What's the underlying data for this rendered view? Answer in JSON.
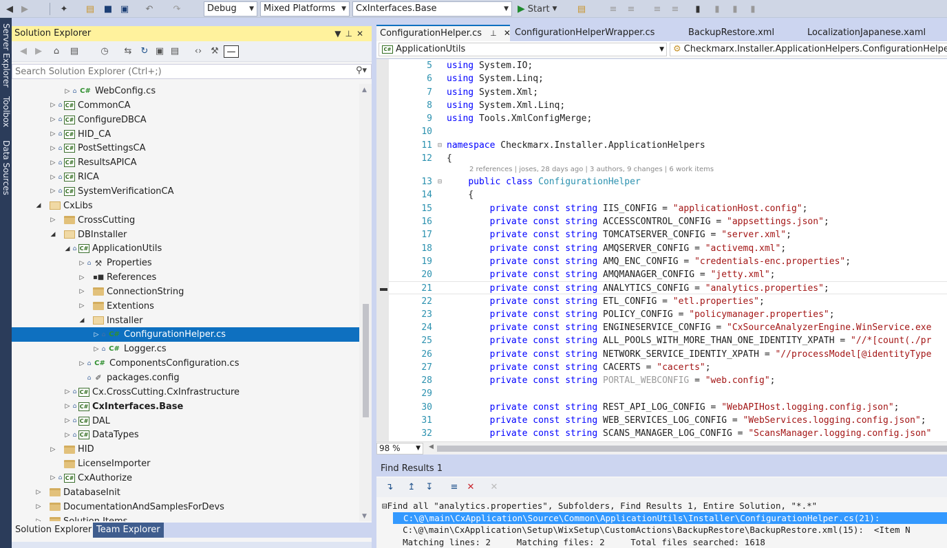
{
  "toolbar": {
    "config": "Debug",
    "platform": "Mixed Platforms",
    "startup_project": "CxInterfaces.Base",
    "start_label": "Start"
  },
  "left_strip": {
    "tabs": [
      "Server Explorer",
      "Toolbox",
      "Data Sources"
    ]
  },
  "solution_explorer": {
    "title": "Solution Explorer",
    "search_placeholder": "Search Solution Explorer (Ctrl+;)",
    "tree": [
      {
        "label": "WebConfig.cs",
        "indent": 3,
        "expander": "collapsed",
        "lock": true,
        "icon": "cs"
      },
      {
        "label": "CommonCA",
        "indent": 2,
        "expander": "collapsed",
        "lock": true,
        "icon": "proj"
      },
      {
        "label": "ConfigureDBCA",
        "indent": 2,
        "expander": "collapsed",
        "lock": true,
        "icon": "proj"
      },
      {
        "label": "HID_CA",
        "indent": 2,
        "expander": "collapsed",
        "lock": true,
        "icon": "proj"
      },
      {
        "label": "PostSettingsCA",
        "indent": 2,
        "expander": "collapsed",
        "lock": true,
        "icon": "proj"
      },
      {
        "label": "ResultsAPICA",
        "indent": 2,
        "expander": "collapsed",
        "lock": true,
        "icon": "proj"
      },
      {
        "label": "RICA",
        "indent": 2,
        "expander": "collapsed",
        "lock": true,
        "icon": "proj"
      },
      {
        "label": "SystemVerificationCA",
        "indent": 2,
        "expander": "collapsed",
        "lock": true,
        "icon": "proj"
      },
      {
        "label": "CxLibs",
        "indent": 1,
        "expander": "expanded",
        "lock": false,
        "icon": "open"
      },
      {
        "label": "CrossCutting",
        "indent": 2,
        "expander": "collapsed",
        "lock": false,
        "icon": "folder"
      },
      {
        "label": "DBInstaller",
        "indent": 2,
        "expander": "expanded",
        "lock": false,
        "icon": "open"
      },
      {
        "label": "ApplicationUtils",
        "indent": 3,
        "expander": "expanded",
        "lock": true,
        "icon": "proj"
      },
      {
        "label": "Properties",
        "indent": 4,
        "expander": "collapsed",
        "lock": true,
        "icon": "wrench"
      },
      {
        "label": "References",
        "indent": 4,
        "expander": "collapsed",
        "lock": false,
        "icon": "refs"
      },
      {
        "label": "ConnectionString",
        "indent": 4,
        "expander": "collapsed",
        "lock": false,
        "icon": "folder"
      },
      {
        "label": "Extentions",
        "indent": 4,
        "expander": "collapsed",
        "lock": false,
        "icon": "folder"
      },
      {
        "label": "Installer",
        "indent": 4,
        "expander": "expanded",
        "lock": false,
        "icon": "open"
      },
      {
        "label": "ConfigurationHelper.cs",
        "indent": 5,
        "expander": "collapsed",
        "lock": true,
        "icon": "cs",
        "selected": true
      },
      {
        "label": "Logger.cs",
        "indent": 5,
        "expander": "collapsed",
        "lock": true,
        "icon": "cs"
      },
      {
        "label": "ComponentsConfiguration.cs",
        "indent": 4,
        "expander": "collapsed",
        "lock": true,
        "icon": "cs"
      },
      {
        "label": "packages.config",
        "indent": 4,
        "expander": "none",
        "lock": true,
        "icon": "pkg"
      },
      {
        "label": "Cx.CrossCutting.CxInfrastructure",
        "indent": 3,
        "expander": "collapsed",
        "lock": true,
        "icon": "proj"
      },
      {
        "label": "CxInterfaces.Base",
        "indent": 3,
        "expander": "collapsed",
        "lock": true,
        "icon": "proj",
        "bold": true
      },
      {
        "label": "DAL",
        "indent": 3,
        "expander": "collapsed",
        "lock": true,
        "icon": "proj"
      },
      {
        "label": "DataTypes",
        "indent": 3,
        "expander": "collapsed",
        "lock": true,
        "icon": "proj"
      },
      {
        "label": "HID",
        "indent": 2,
        "expander": "collapsed",
        "lock": false,
        "icon": "folder"
      },
      {
        "label": "LicenseImporter",
        "indent": 2,
        "expander": "none",
        "lock": false,
        "icon": "folder"
      },
      {
        "label": "CxAuthorize",
        "indent": 2,
        "expander": "collapsed",
        "lock": true,
        "icon": "proj"
      },
      {
        "label": "DatabaseInit",
        "indent": 1,
        "expander": "collapsed",
        "lock": false,
        "icon": "folder"
      },
      {
        "label": "DocumentationAndSamplesForDevs",
        "indent": 1,
        "expander": "collapsed",
        "lock": false,
        "icon": "folder"
      },
      {
        "label": "Solution Items",
        "indent": 1,
        "expander": "collapsed",
        "lock": false,
        "icon": "folder"
      }
    ],
    "bottom_tabs": [
      "Solution Explorer",
      "Team Explorer"
    ]
  },
  "editor": {
    "tabs": [
      {
        "label": "ConfigurationHelper.cs",
        "active": true
      },
      {
        "label": "ConfigurationHelperWrapper.cs",
        "active": false
      },
      {
        "label": "BackupRestore.xml",
        "active": false
      },
      {
        "label": "LocalizationJapanese.xaml",
        "active": false
      }
    ],
    "nav_left": "ApplicationUtils",
    "nav_right": "Checkmarx.Installer.ApplicationHelpers.ConfigurationHelper",
    "codelens": "2 references | joses, 28 days ago | 3 authors, 9 changes | 6 work items",
    "zoom": "98 %",
    "lines": [
      {
        "n": "5",
        "code": "using System.IO;"
      },
      {
        "n": "6",
        "code": "using System.Linq;"
      },
      {
        "n": "7",
        "code": "using System.Xml;"
      },
      {
        "n": "8",
        "code": "using System.Xml.Linq;"
      },
      {
        "n": "9",
        "code": "using Tools.XmlConfigMerge;"
      },
      {
        "n": "10",
        "code": ""
      },
      {
        "n": "11",
        "code": "namespace Checkmarx.Installer.ApplicationHelpers"
      },
      {
        "n": "12",
        "code": "{"
      },
      {
        "n": "13",
        "code": "    public class ConfigurationHelper"
      },
      {
        "n": "14",
        "code": "    {"
      },
      {
        "n": "15",
        "code": "        private const string IIS_CONFIG = \"applicationHost.config\";"
      },
      {
        "n": "16",
        "code": "        private const string ACCESSCONTROL_CONFIG = \"appsettings.json\";"
      },
      {
        "n": "17",
        "code": "        private const string TOMCATSERVER_CONFIG = \"server.xml\";"
      },
      {
        "n": "18",
        "code": "        private const string AMQSERVER_CONFIG = \"activemq.xml\";"
      },
      {
        "n": "19",
        "code": "        private const string AMQ_ENC_CONFIG = \"credentials-enc.properties\";"
      },
      {
        "n": "20",
        "code": "        private const string AMQMANAGER_CONFIG = \"jetty.xml\";"
      },
      {
        "n": "21",
        "code": "        private const string ANALYTICS_CONFIG = \"analytics.properties\";"
      },
      {
        "n": "22",
        "code": "        private const string ETL_CONFIG = \"etl.properties\";"
      },
      {
        "n": "23",
        "code": "        private const string POLICY_CONFIG = \"policymanager.properties\";"
      },
      {
        "n": "24",
        "code": "        private const string ENGINESERVICE_CONFIG = \"CxSourceAnalyzerEngine.WinService.exe"
      },
      {
        "n": "25",
        "code": "        private const string ALL_POOLS_WITH_MORE_THAN_ONE_IDENTITY_XPATH = \"//*[count(./pr"
      },
      {
        "n": "26",
        "code": "        private const string NETWORK_SERVICE_IDENTIY_XPATH = \"//processModel[@identityType"
      },
      {
        "n": "27",
        "code": "        private const string CACERTS = \"cacerts\";"
      },
      {
        "n": "28",
        "code": "        private const string PORTAL_WEBCONFIG = \"web.config\";"
      },
      {
        "n": "29",
        "code": ""
      },
      {
        "n": "30",
        "code": "        private const string REST_API_LOG_CONFIG = \"WebAPIHost.logging.config.json\";"
      },
      {
        "n": "31",
        "code": "        private const string WEB_SERVICES_LOG_CONFIG = \"WebServices.logging.config.json\";"
      },
      {
        "n": "32",
        "code": "        private const string SCANS_MANAGER_LOG_CONFIG = \"ScansManager.logging.config.json\""
      }
    ]
  },
  "find_results": {
    "title": "Find Results 1",
    "lines": [
      {
        "text": "Find all \"analytics.properties\", Subfolders, Find Results 1, Entire Solution, \"*.*\"",
        "selected": false
      },
      {
        "text": "  C:\\@\\main\\CxApplication\\Source\\Common\\ApplicationUtils\\Installer\\ConfigurationHelper.cs(21):",
        "selected": true
      },
      {
        "text": "    C:\\@\\main\\CxApplication\\Setup\\WixSetup\\CustomActions\\BackupRestore\\BackupRestore.xml(15):  <Item N",
        "selected": false
      },
      {
        "text": "    Matching lines: 2     Matching files: 2     Total files searched: 1618",
        "selected": false
      }
    ]
  },
  "colors": {
    "selection": "#0e70c0",
    "title_active": "#fff29d",
    "keyword": "#0000ff",
    "type": "#2b91af",
    "string": "#a31515"
  }
}
